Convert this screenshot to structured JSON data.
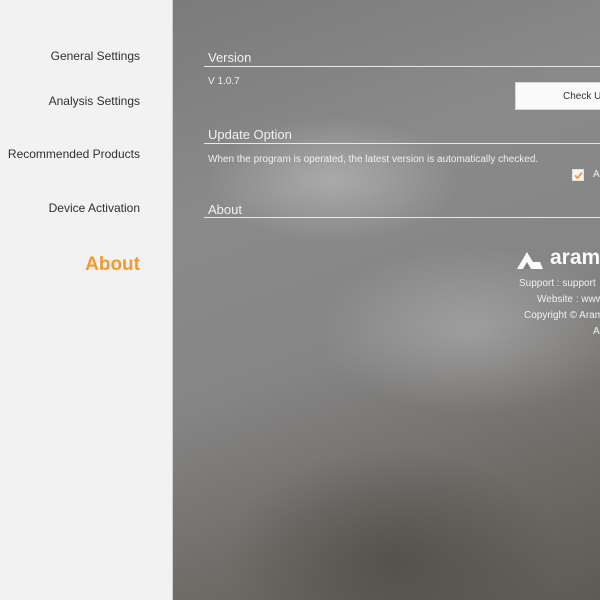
{
  "sidebar": {
    "items": [
      {
        "label": "General Settings"
      },
      {
        "label": "Analysis Settings"
      },
      {
        "label": "Recommended Products"
      },
      {
        "label": "Device Activation"
      },
      {
        "label": "About",
        "active": true
      }
    ]
  },
  "version": {
    "title": "Version",
    "value": "V 1.0.7",
    "check_button_label": "Check U"
  },
  "update_option": {
    "title": "Update Option",
    "description": "When the program is operated, the latest version is automatically checked.",
    "checkbox_label": "A",
    "checkbox_checked": true
  },
  "about": {
    "title": "About",
    "brand": "aram",
    "support": "Support : support",
    "website": "Website : www",
    "copyright": "Copyright © Aram",
    "last_line": "A"
  },
  "colors": {
    "accent": "#f29a2e",
    "sidebar_bg": "#f2f2f2",
    "main_bg": "#858585"
  }
}
